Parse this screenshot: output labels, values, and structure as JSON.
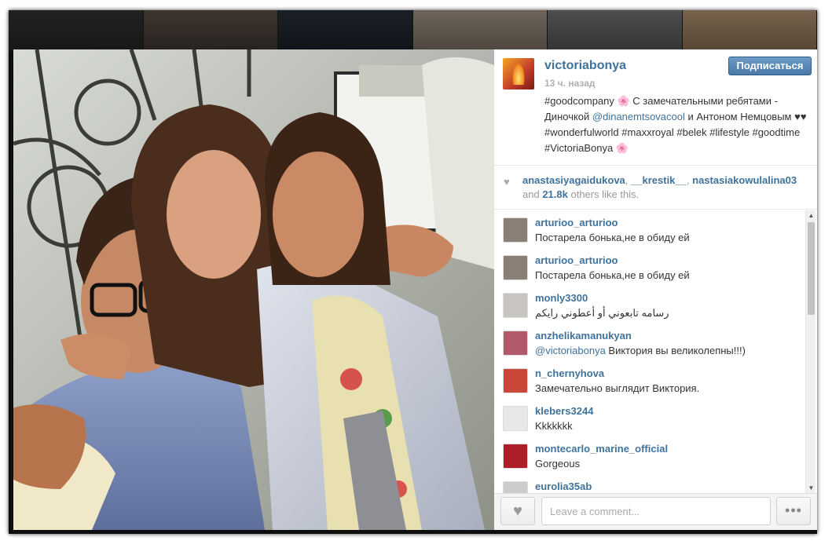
{
  "post": {
    "username": "victoriabonya",
    "time": "13 ч. назад",
    "follow_label": "Подписаться",
    "caption": {
      "part1": "#goodcompany 🌸 С замечательными ребятами - Диночкой ",
      "mention": "@dinanemtsovacool",
      "part2": " и Антоном Немцовым ♥♥ #wonderfulworld #maxxroyal #belek #lifestyle #goodtime #VictoriaBonya 🌸"
    }
  },
  "likes": {
    "user1": "anastasiyagaidukova",
    "sep1": ", ",
    "user2": "__krestik__",
    "sep2": ",",
    "user3": "nastasiakowulalina03",
    "mid": " and ",
    "count": "21.8k",
    "tail": " others like this."
  },
  "comments": [
    {
      "user": "arturioo_arturioo",
      "text": "Постарела бонька,не в обиду ей",
      "avatar_color": "#8a7f74"
    },
    {
      "user": "arturioo_arturioo",
      "text": "Постарела бонька,не в обиду ей",
      "avatar_color": "#8a7f74"
    },
    {
      "user": "monly3300",
      "text": "رسامه تابعوني أو أعطوني رايكم",
      "avatar_color": "#c8c4bf"
    },
    {
      "user": "anzhelikamanukyan",
      "mention": "@victoriabonya",
      "text": " Виктория вы великолепны!!!)",
      "avatar_color": "#b05a6a"
    },
    {
      "user": "n_chernyhova",
      "text": "Замечательно выглядит Виктория.",
      "avatar_color": "#c9483a"
    },
    {
      "user": "klebers3244",
      "text": "Kkkkkkk",
      "avatar_color": "#e8e8e8"
    },
    {
      "user": "montecarlo_marine_official",
      "text": "Gorgeous",
      "avatar_color": "#b01e2a"
    },
    {
      "user": "eurolia35ab",
      "text": "",
      "avatar_color": "#cccccc"
    }
  ],
  "footer": {
    "comment_placeholder": "Leave a comment...",
    "like_icon": "heart-icon",
    "more_label": "•••"
  },
  "colors": {
    "link": "#3f729b",
    "follow_button": "#4b79a8"
  }
}
